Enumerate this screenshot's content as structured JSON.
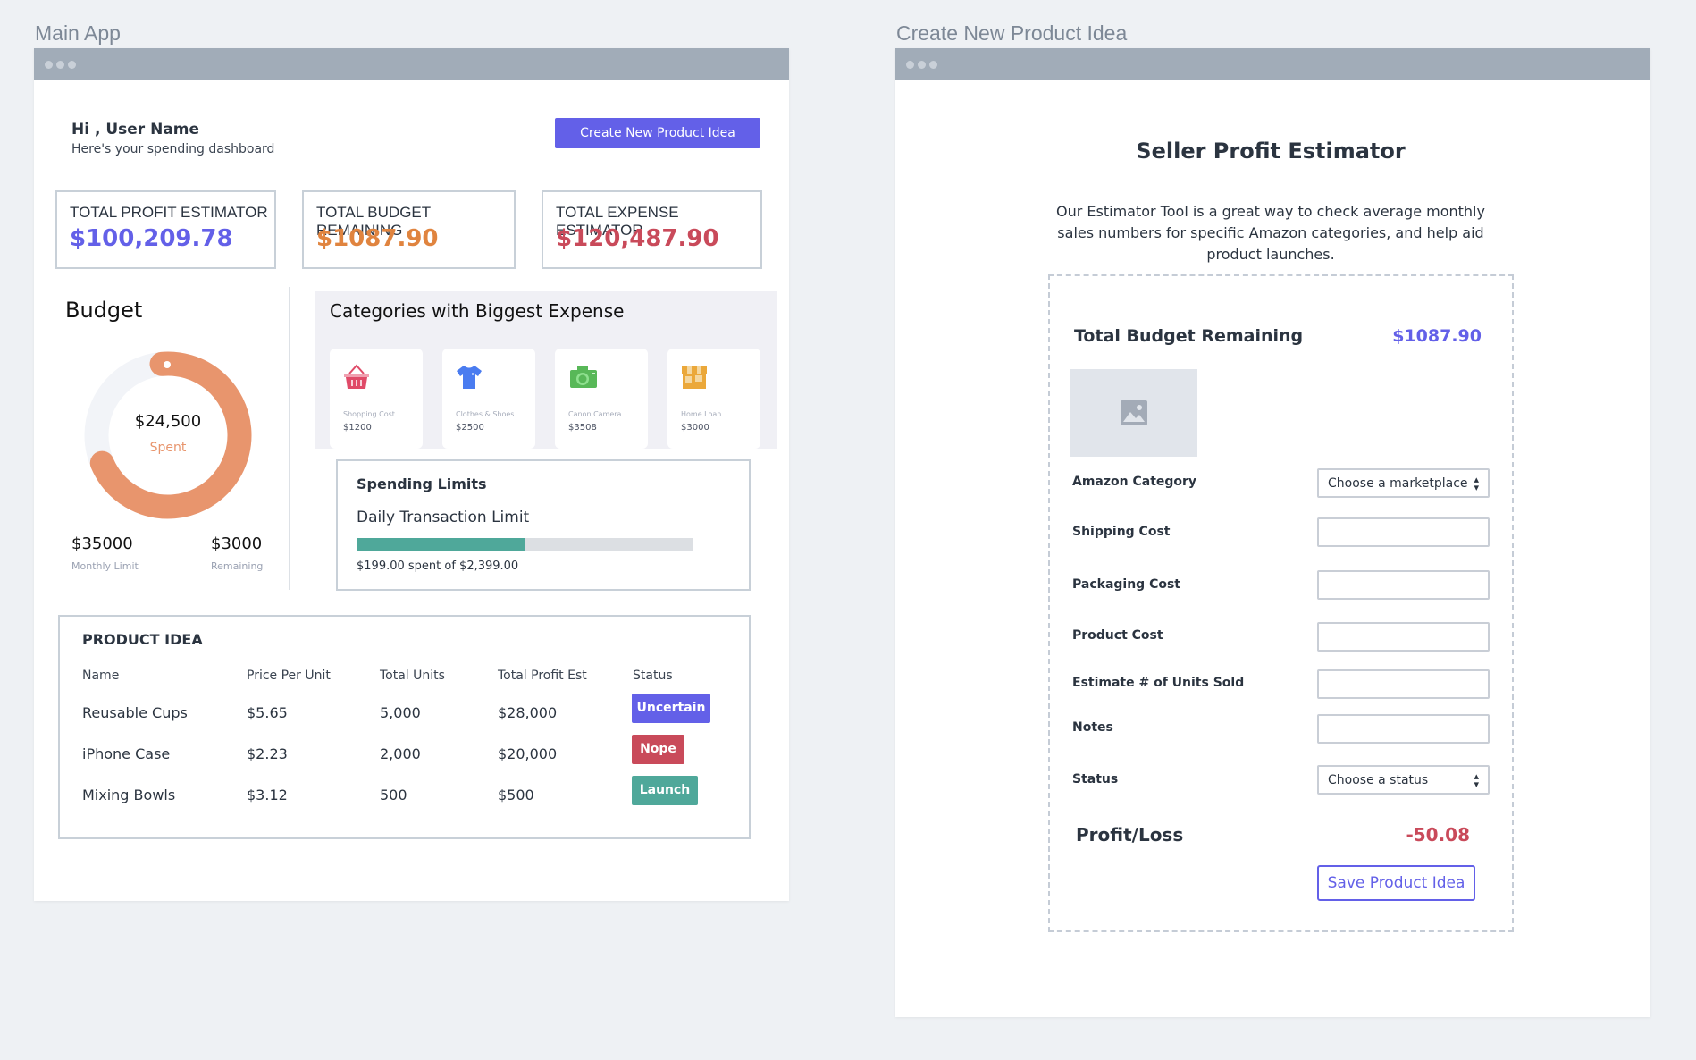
{
  "frames": {
    "left_label": "Main App",
    "right_label": "Create New Product Idea"
  },
  "dashboard": {
    "greeting": "Hi , User Name",
    "subtitle": "Here's your spending dashboard",
    "create_button": "Create New Product Idea",
    "stats": [
      {
        "label": "TOTAL PROFIT ESTIMATOR",
        "value": "$100,209.78",
        "color": "#6360e8"
      },
      {
        "label": "TOTAL BUDGET REMAINING",
        "value": "$1087.90",
        "color": "#e0843f"
      },
      {
        "label": "TOTAL EXPENSE ESTIMATOR",
        "value": "$120,487.90",
        "color": "#c94a5a"
      }
    ],
    "budget": {
      "title": "Budget",
      "spent_value": "$24,500",
      "spent_label": "Spent",
      "spent_fraction": 0.7,
      "monthly_limit": "$35000",
      "monthly_limit_label": "Monthly Limit",
      "remaining": "$3000",
      "remaining_label": "Remaining"
    },
    "categories": {
      "title": "Categories with Biggest Expense",
      "items": [
        {
          "icon": "basket-icon",
          "label": "Shopping Cost",
          "value": "$1200"
        },
        {
          "icon": "tshirt-icon",
          "label": "Clothes & Shoes",
          "value": "$2500"
        },
        {
          "icon": "camera-icon",
          "label": "Canon Camera",
          "value": "$3508"
        },
        {
          "icon": "store-icon",
          "label": "Home Loan",
          "value": "$3000"
        }
      ]
    },
    "spending": {
      "title": "Spending Limits",
      "subtitle": "Daily Transaction Limit",
      "progress": 0.5,
      "caption": "$199.00 spent of $2,399.00"
    },
    "products": {
      "title": "PRODUCT IDEA",
      "headers": [
        "Name",
        "Price Per Unit",
        "Total Units",
        "Total Profit Est",
        "Status"
      ],
      "rows": [
        {
          "name": "Reusable Cups",
          "price": "$5.65",
          "units": "5,000",
          "profit": "$28,000",
          "status": "Uncertain",
          "color": "#6360e8"
        },
        {
          "name": "iPhone Case",
          "price": "$2.23",
          "units": "2,000",
          "profit": "$20,000",
          "status": "Nope",
          "color": "#c94a5a"
        },
        {
          "name": "Mixing Bowls",
          "price": "$3.12",
          "units": "500",
          "profit": "$500",
          "status": "Launch",
          "color": "#4fa89a"
        }
      ]
    }
  },
  "estimator": {
    "title": "Seller Profit Estimator",
    "description": [
      "Our Estimator Tool is a great way to check average monthly",
      "sales numbers for specific Amazon categories, and help aid",
      "product launches."
    ],
    "budget_label": "Total Budget Remaining",
    "budget_value": "$1087.90",
    "fields": {
      "category": "Amazon Category",
      "category_placeholder": "Choose a marketplace",
      "shipping": "Shipping Cost",
      "packaging": "Packaging Cost",
      "product": "Product Cost",
      "units": "Estimate # of Units Sold",
      "notes": "Notes",
      "status": "Status",
      "status_placeholder": "Choose a status"
    },
    "profit_label": "Profit/Loss",
    "profit_value": "-50.08",
    "save_button": "Save Product Idea"
  }
}
